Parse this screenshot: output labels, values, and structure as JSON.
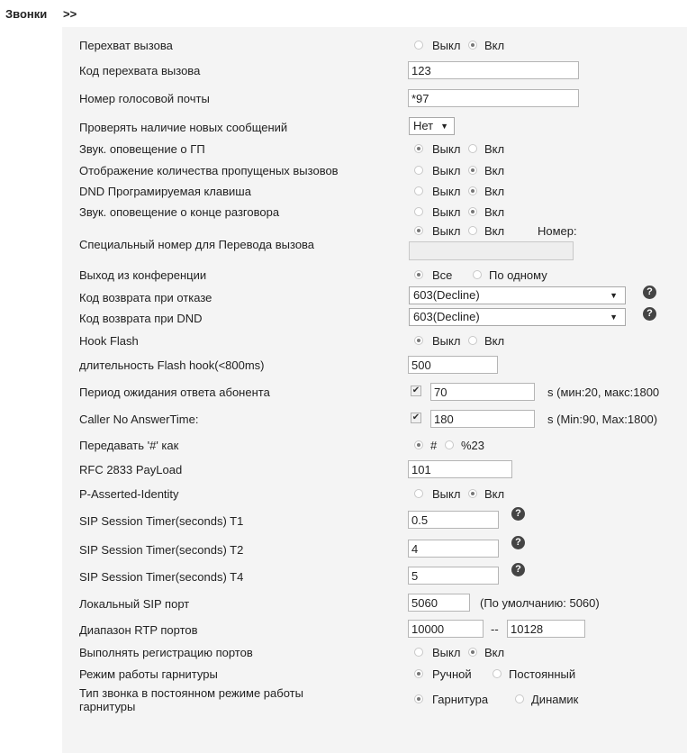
{
  "section": {
    "title": "Звонки",
    "arrows": ">>"
  },
  "rows": {
    "call_pickup": {
      "label": "Перехват вызова",
      "off": "Выкл",
      "on": "Вкл",
      "selected": "on"
    },
    "pickup_code": {
      "label": "Код перехвата вызова",
      "value": "123"
    },
    "voicemail_number": {
      "label": "Номер голосовой почты",
      "value": "*97"
    },
    "check_messages": {
      "label": "Проверять наличие новых сообщений",
      "value": "Нет"
    },
    "vm_sound": {
      "label": "Звук. оповещение о ГП",
      "off": "Выкл",
      "on": "Вкл",
      "selected": "off"
    },
    "missed_count": {
      "label": "Отображение количества пропущеных вызовов",
      "off": "Выкл",
      "on": "Вкл",
      "selected": "on"
    },
    "dnd_key": {
      "label": "DND Програмируемая клавиша",
      "off": "Выкл",
      "on": "Вкл",
      "selected": "on"
    },
    "end_call_sound": {
      "label": "Звук. оповещение о конце разговора",
      "off": "Выкл",
      "on": "Вкл",
      "selected": "on"
    },
    "special_transfer": {
      "label": "Специальный номер для Перевода вызова",
      "off": "Выкл",
      "on": "Вкл",
      "number_label": "Номер:",
      "selected": "off",
      "value": ""
    },
    "conference_exit": {
      "label": "Выход из конференции",
      "all": "Все",
      "one": "По одному",
      "selected": "all"
    },
    "reject_code": {
      "label": "Код возврата при отказе",
      "value": "603(Decline)"
    },
    "dnd_code": {
      "label": "Код возврата при DND",
      "value": "603(Decline)"
    },
    "hook_flash": {
      "label": "Hook Flash",
      "off": "Выкл",
      "on": "Вкл",
      "selected": "off"
    },
    "flash_duration": {
      "label": "длительность Flash hook(<800ms)",
      "value": "500"
    },
    "answer_wait": {
      "label": "Период ожидания ответа абонента",
      "value": "70",
      "checked": true,
      "hint": "s  (мин:20, макс:1800"
    },
    "caller_no_answer": {
      "label": "Caller No AnswerTime:",
      "value": "180",
      "checked": true,
      "hint": "s  (Min:90, Max:1800)"
    },
    "hash_send": {
      "label": "Передавать '#' как",
      "a": "#",
      "b": "%23",
      "selected": "a"
    },
    "rfc2833": {
      "label": "RFC 2833 PayLoad",
      "value": "101"
    },
    "pai": {
      "label": "P-Asserted-Identity",
      "off": "Выкл",
      "on": "Вкл",
      "selected": "on"
    },
    "timer_t1": {
      "label": "SIP Session Timer(seconds) T1",
      "value": "0.5"
    },
    "timer_t2": {
      "label": "SIP Session Timer(seconds) T2",
      "value": "4"
    },
    "timer_t4": {
      "label": "SIP Session Timer(seconds) T4",
      "value": "5"
    },
    "sip_port": {
      "label": "Локальный SIP порт",
      "value": "5060",
      "hint": "(По умолчанию: 5060)"
    },
    "rtp_range": {
      "label": "Диапазон RTP портов",
      "from": "10000",
      "sep": "--",
      "to": "10128"
    },
    "port_register": {
      "label": "Выполнять регистрацию портов",
      "off": "Выкл",
      "on": "Вкл",
      "selected": "on"
    },
    "headset_mode": {
      "label": "Режим работы гарнитуры",
      "manual": "Ручной",
      "constant": "Постоянный",
      "selected": "manual"
    },
    "headset_ring": {
      "label": "Тип звонка в постоянном режиме работы гарнитуры",
      "headset": "Гарнитура",
      "speaker": "Динамик",
      "selected": "headset"
    }
  },
  "help_glyph": "?",
  "select_arrow": "▼",
  "check_glyph": "✔"
}
